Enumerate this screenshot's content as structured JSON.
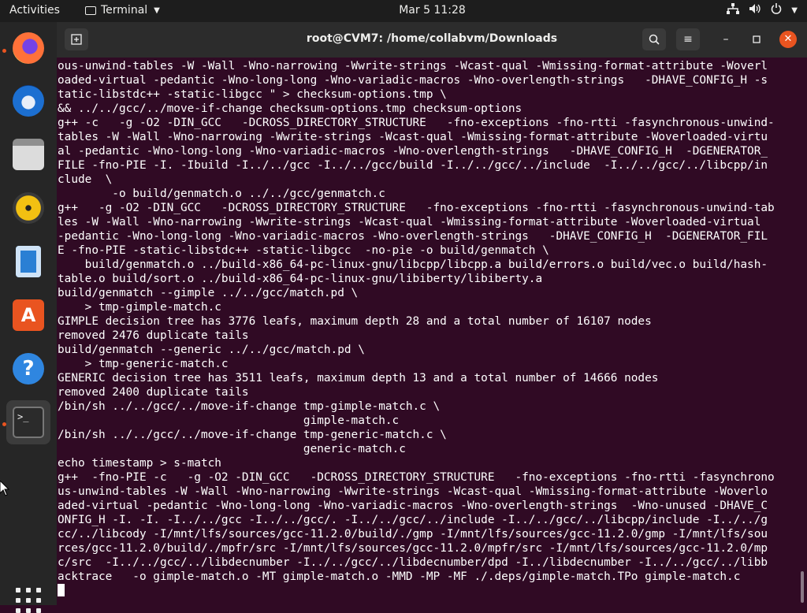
{
  "topbar": {
    "activities": "Activities",
    "app_name": "Terminal",
    "clock": "Mar 5  11:28"
  },
  "dock": {
    "items": [
      "firefox-icon",
      "thunderbird-icon",
      "files-icon",
      "rhythmbox-icon",
      "libreoffice-writer-icon",
      "software-icon",
      "help-icon",
      "terminal-icon"
    ],
    "accent": "#e95420"
  },
  "window": {
    "title": "root@CVM7: /home/collabvm/Downloads"
  },
  "terminal": {
    "lines": [
      "ous-unwind-tables -W -Wall -Wno-narrowing -Wwrite-strings -Wcast-qual -Wmissing-format-attribute -Woverl",
      "oaded-virtual -pedantic -Wno-long-long -Wno-variadic-macros -Wno-overlength-strings   -DHAVE_CONFIG_H -s",
      "tatic-libstdc++ -static-libgcc \" > checksum-options.tmp \\",
      "&& ../../gcc/../move-if-change checksum-options.tmp checksum-options",
      "g++ -c   -g -O2 -DIN_GCC   -DCROSS_DIRECTORY_STRUCTURE   -fno-exceptions -fno-rtti -fasynchronous-unwind-",
      "tables -W -Wall -Wno-narrowing -Wwrite-strings -Wcast-qual -Wmissing-format-attribute -Woverloaded-virtu",
      "al -pedantic -Wno-long-long -Wno-variadic-macros -Wno-overlength-strings   -DHAVE_CONFIG_H  -DGENERATOR_",
      "FILE -fno-PIE -I. -Ibuild -I../../gcc -I../../gcc/build -I../../gcc/../include  -I../../gcc/../libcpp/in",
      "clude  \\",
      "        -o build/genmatch.o ../../gcc/genmatch.c",
      "g++   -g -O2 -DIN_GCC   -DCROSS_DIRECTORY_STRUCTURE   -fno-exceptions -fno-rtti -fasynchronous-unwind-tab",
      "les -W -Wall -Wno-narrowing -Wwrite-strings -Wcast-qual -Wmissing-format-attribute -Woverloaded-virtual",
      "-pedantic -Wno-long-long -Wno-variadic-macros -Wno-overlength-strings   -DHAVE_CONFIG_H  -DGENERATOR_FIL",
      "E -fno-PIE -static-libstdc++ -static-libgcc  -no-pie -o build/genmatch \\",
      "    build/genmatch.o ../build-x86_64-pc-linux-gnu/libcpp/libcpp.a build/errors.o build/vec.o build/hash-",
      "table.o build/sort.o ../build-x86_64-pc-linux-gnu/libiberty/libiberty.a",
      "build/genmatch --gimple ../../gcc/match.pd \\",
      "    > tmp-gimple-match.c",
      "GIMPLE decision tree has 3776 leafs, maximum depth 28 and a total number of 16107 nodes",
      "removed 2476 duplicate tails",
      "build/genmatch --generic ../../gcc/match.pd \\",
      "    > tmp-generic-match.c",
      "GENERIC decision tree has 3511 leafs, maximum depth 13 and a total number of 14666 nodes",
      "removed 2400 duplicate tails",
      "/bin/sh ../../gcc/../move-if-change tmp-gimple-match.c \\",
      "                                    gimple-match.c",
      "/bin/sh ../../gcc/../move-if-change tmp-generic-match.c \\",
      "                                    generic-match.c",
      "echo timestamp > s-match",
      "g++  -fno-PIE -c   -g -O2 -DIN_GCC   -DCROSS_DIRECTORY_STRUCTURE   -fno-exceptions -fno-rtti -fasynchrono",
      "us-unwind-tables -W -Wall -Wno-narrowing -Wwrite-strings -Wcast-qual -Wmissing-format-attribute -Woverlo",
      "aded-virtual -pedantic -Wno-long-long -Wno-variadic-macros -Wno-overlength-strings  -Wno-unused -DHAVE_C",
      "ONFIG_H -I. -I. -I../../gcc -I../../gcc/. -I../../gcc/../include -I../../gcc/../libcpp/include -I../../g",
      "cc/../libcody -I/mnt/lfs/sources/gcc-11.2.0/build/./gmp -I/mnt/lfs/sources/gcc-11.2.0/gmp -I/mnt/lfs/sou",
      "rces/gcc-11.2.0/build/./mpfr/src -I/mnt/lfs/sources/gcc-11.2.0/mpfr/src -I/mnt/lfs/sources/gcc-11.2.0/mp",
      "c/src  -I../../gcc/../libdecnumber -I../../gcc/../libdecnumber/dpd -I../libdecnumber -I../../gcc/../libb",
      "acktrace   -o gimple-match.o -MT gimple-match.o -MMD -MP -MF ./.deps/gimple-match.TPo gimple-match.c"
    ]
  }
}
